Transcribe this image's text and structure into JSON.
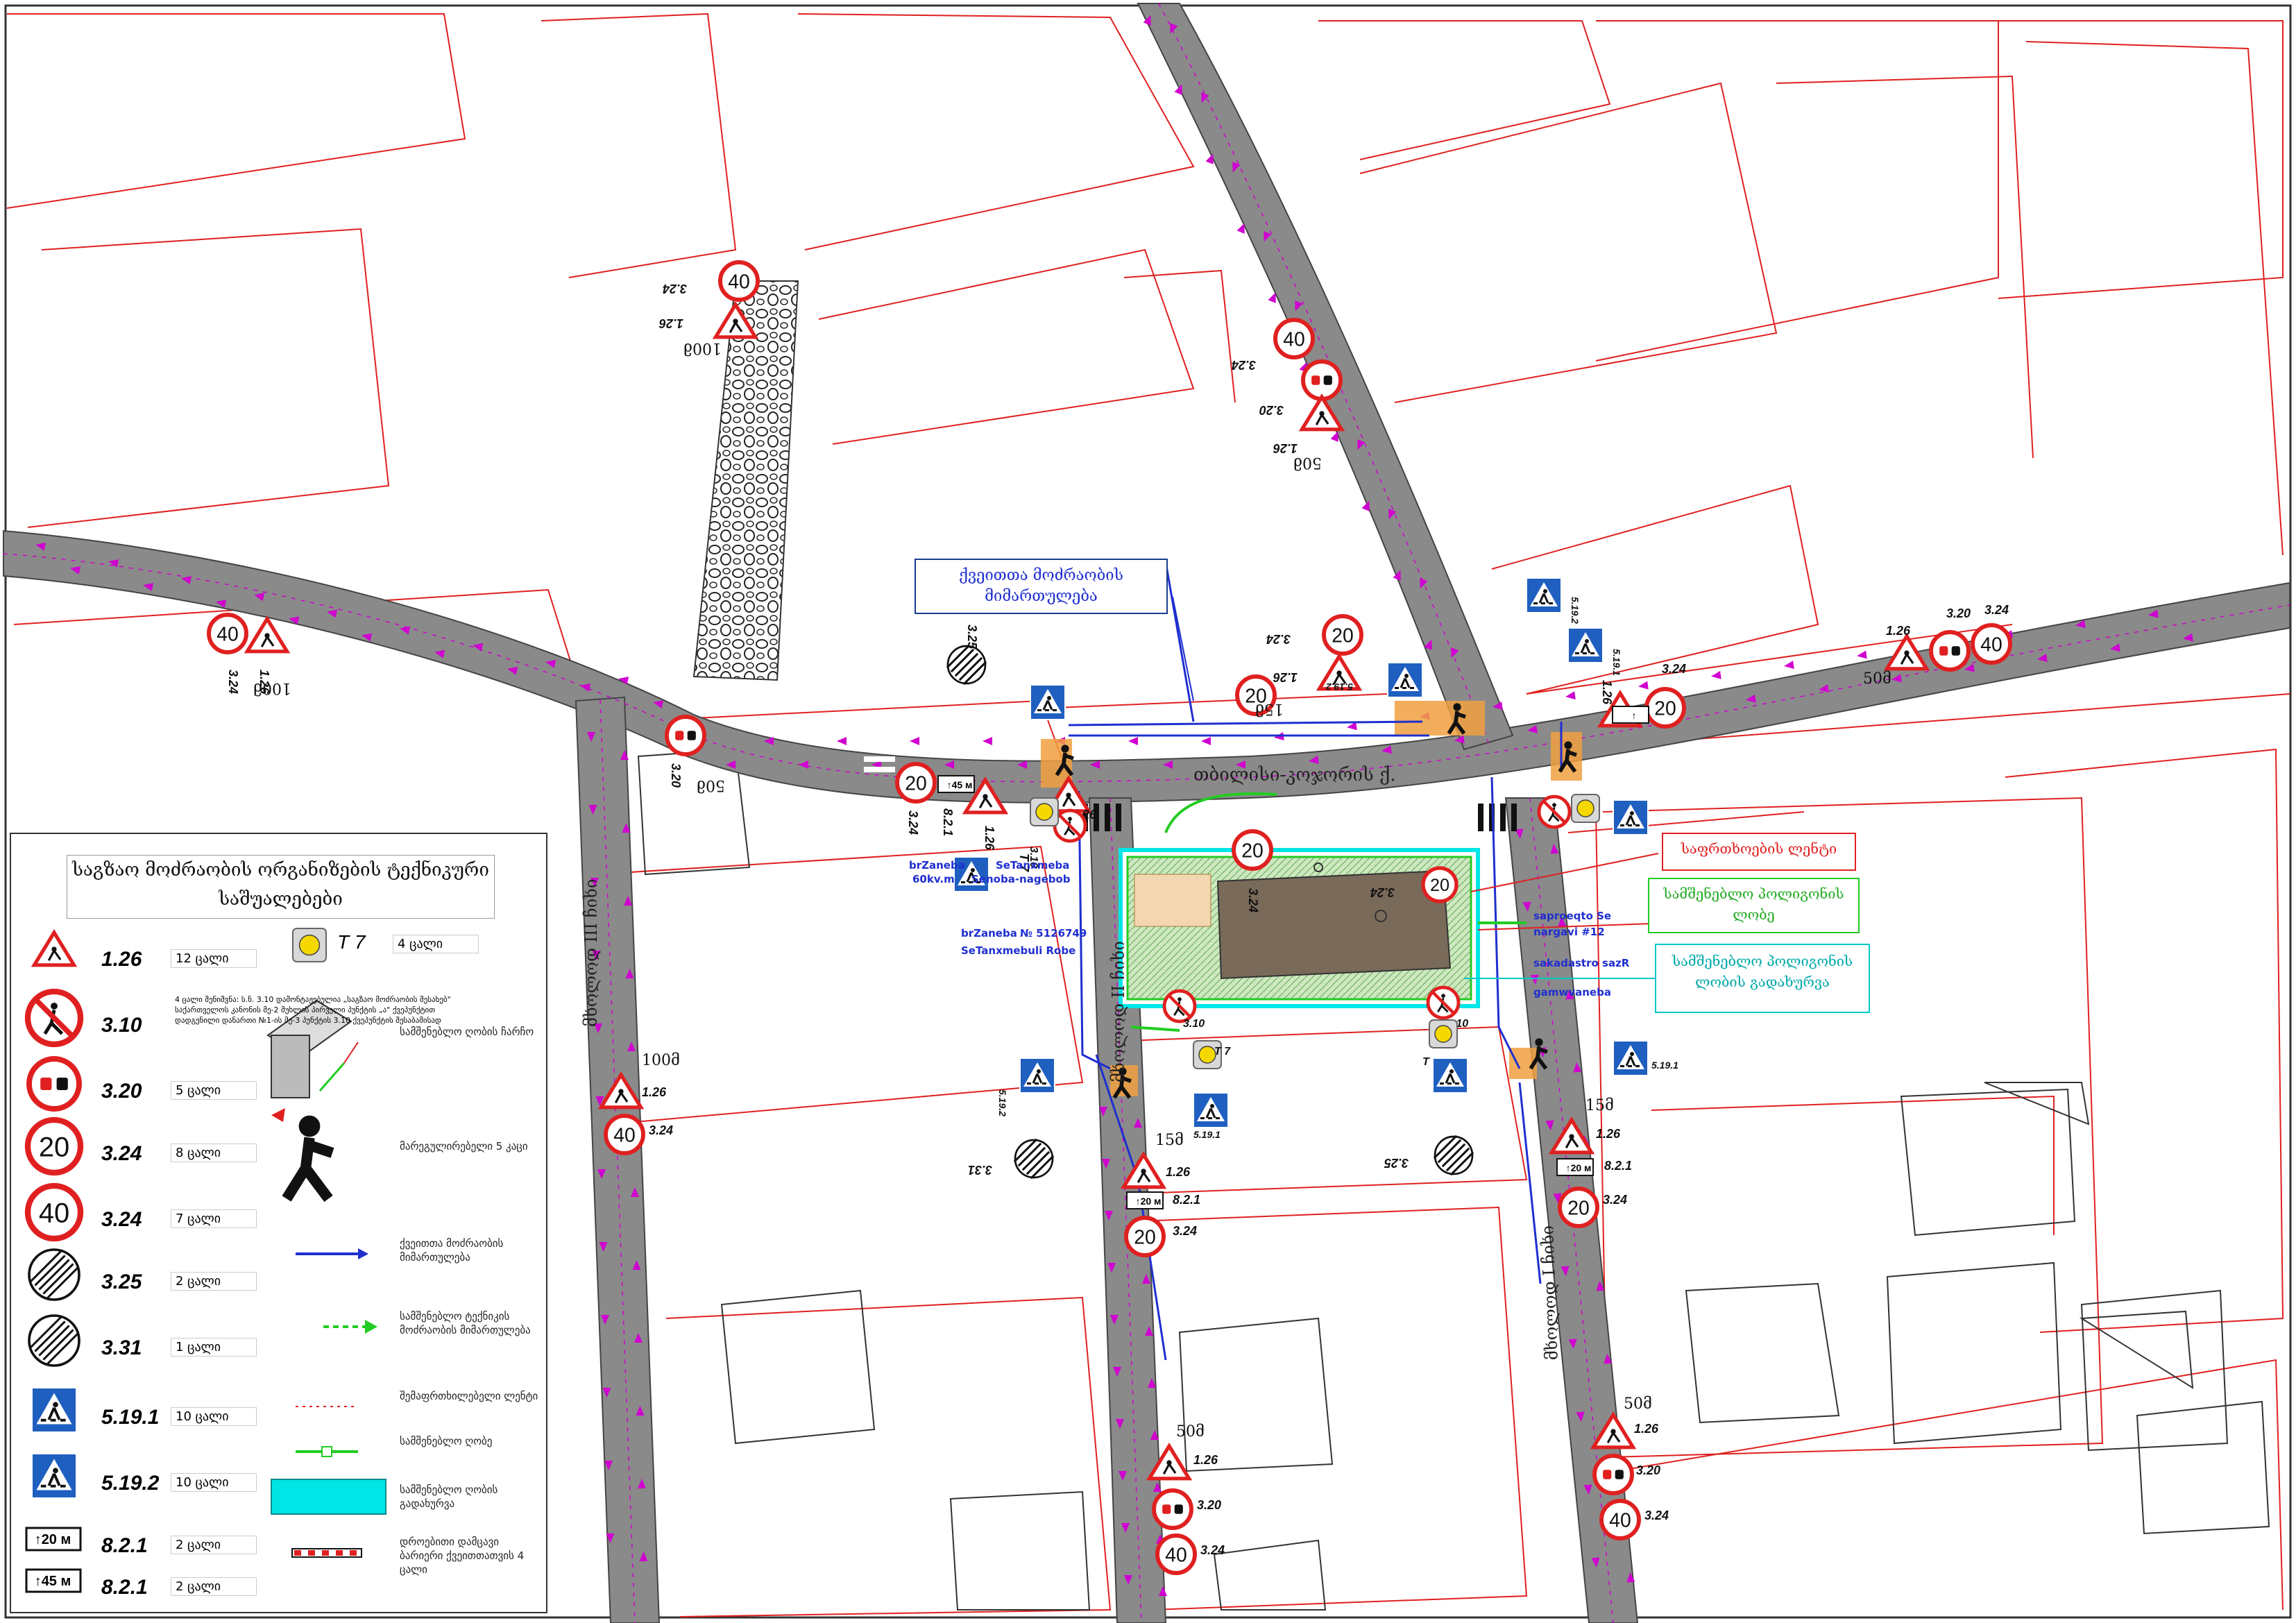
{
  "colors": {
    "road": "#8a8a8a",
    "parcel_line": "#e02020",
    "building_fill": "#7a6a5a",
    "direction_arrow": "#d000d0",
    "route_blue": "#1f2fd0",
    "route_green": "#22cc22",
    "safety_zone": "#00e5e5",
    "sign_red": "#e02020",
    "sign_blue": "#1f5fc0",
    "pedestrian_orange": "#f0a040"
  },
  "streets": {
    "main": "თბილისი-კოჯორის ქ.",
    "side_a": "მხოლოდ III ჩიხი",
    "side_b": "მხოლოდ II ჩიხი",
    "side_c": "მხოლოდ I ჩიხი"
  },
  "notes": {
    "ped_direction": "ქვეითთა მოძრაობის მიმართულება",
    "hazard_line": "საფრთხოების ლენტი",
    "work_zone": "სამშენებლო პოლიგონის ლობე",
    "work_zone_fence": "სამშენებლო პოლიგონის ლობის გადახურვა"
  },
  "site_labels": {
    "brzaneba_1": "brZaneba",
    "seTanxmeba_1": "SeTanxmeba",
    "kv": "60kv.m",
    "nageboba": "Senoba-nagebob",
    "brzaneba_2": "brZaneba",
    "number": "№ 5126749",
    "robe": "SeTanxmebuli Robe",
    "saproeqto": "saproeqto Se",
    "nargavi": "nargavi #12",
    "sakadastro": "sakadastro sazR",
    "gamwvaneba": "gamwvaneba"
  },
  "distances": {
    "d100a": "100მ",
    "d100b": "100მ",
    "d50a": "50მ",
    "d50b": "50მ",
    "d50c": "50მ",
    "d50d": "50მ",
    "d50e": "50მ",
    "d15a": "15მ",
    "d15b": "15მ",
    "d15c": "15მ",
    "d100c": "100მ"
  },
  "sign_codes": {
    "c126": "1.26",
    "c310": "3.10",
    "c320": "3.20",
    "c324": "3.24",
    "c325": "3.25",
    "c331": "3.31",
    "c5191": "5.19.1",
    "c5192": "5.19.2",
    "c821": "8.2.1",
    "speed20": "20",
    "speed40": "40",
    "plate20": "20 м",
    "plate45": "45 м",
    "t7": "T 7"
  },
  "legend": {
    "title": "საგზაო მოძრაობის ორგანიზების ტექნიკური საშუალებები",
    "rows": [
      {
        "code": "1.26",
        "count": "12 ცალი"
      },
      {
        "code": "3.10",
        "count": "4 ცალი"
      },
      {
        "code": "3.20",
        "count": "5 ცალი"
      },
      {
        "code": "3.24",
        "count": "8 ცალი"
      },
      {
        "code": "3.24",
        "count": "7 ცალი"
      },
      {
        "code": "3.25",
        "count": "2 ცალი"
      },
      {
        "code": "3.31",
        "count": "1 ცალი"
      },
      {
        "code": "5.19.1",
        "count": "10 ცალი"
      },
      {
        "code": "5.19.2",
        "count": "10 ცალი"
      },
      {
        "code": "8.2.1",
        "count": "2 ცალი"
      },
      {
        "code": "8.2.1",
        "count": "2 ცალი"
      }
    ],
    "t7": {
      "code": "T 7",
      "count": "4 ცალი"
    },
    "note_310": "შენიშვნა: ს.ნ. 3.10 დამონტაჟებულია „საგზაო მოძრაობის შესახებ\" საქართველოს კანონის მე-2 მუხლის პირველი პუნქტის „ა\" ქვეპუნქტით დადგენილი დანართი №1-ის მე-3 პუნქტის 3.10 ქვეპუნქტის შესაბამისად",
    "right": [
      {
        "text": "სამშენებლო ღობის ჩარჩო"
      },
      {
        "text": "მარეგულირებელი 5 კაცი"
      },
      {
        "text": "ქვეითთა მოძრაობის მიმართულება"
      },
      {
        "text": "სამშენებლო ტექნიკის მოძრაობის მიმართულება"
      },
      {
        "text": "შემაფრთხილებელი ლენტი"
      },
      {
        "text": "სამშენებლო ღობე"
      },
      {
        "text": "სამშენებლო ღობის გადახურვა"
      },
      {
        "text": "დროებითი დამცავი ბარიერი ქვეითთათვის 4 ცალი"
      }
    ]
  }
}
